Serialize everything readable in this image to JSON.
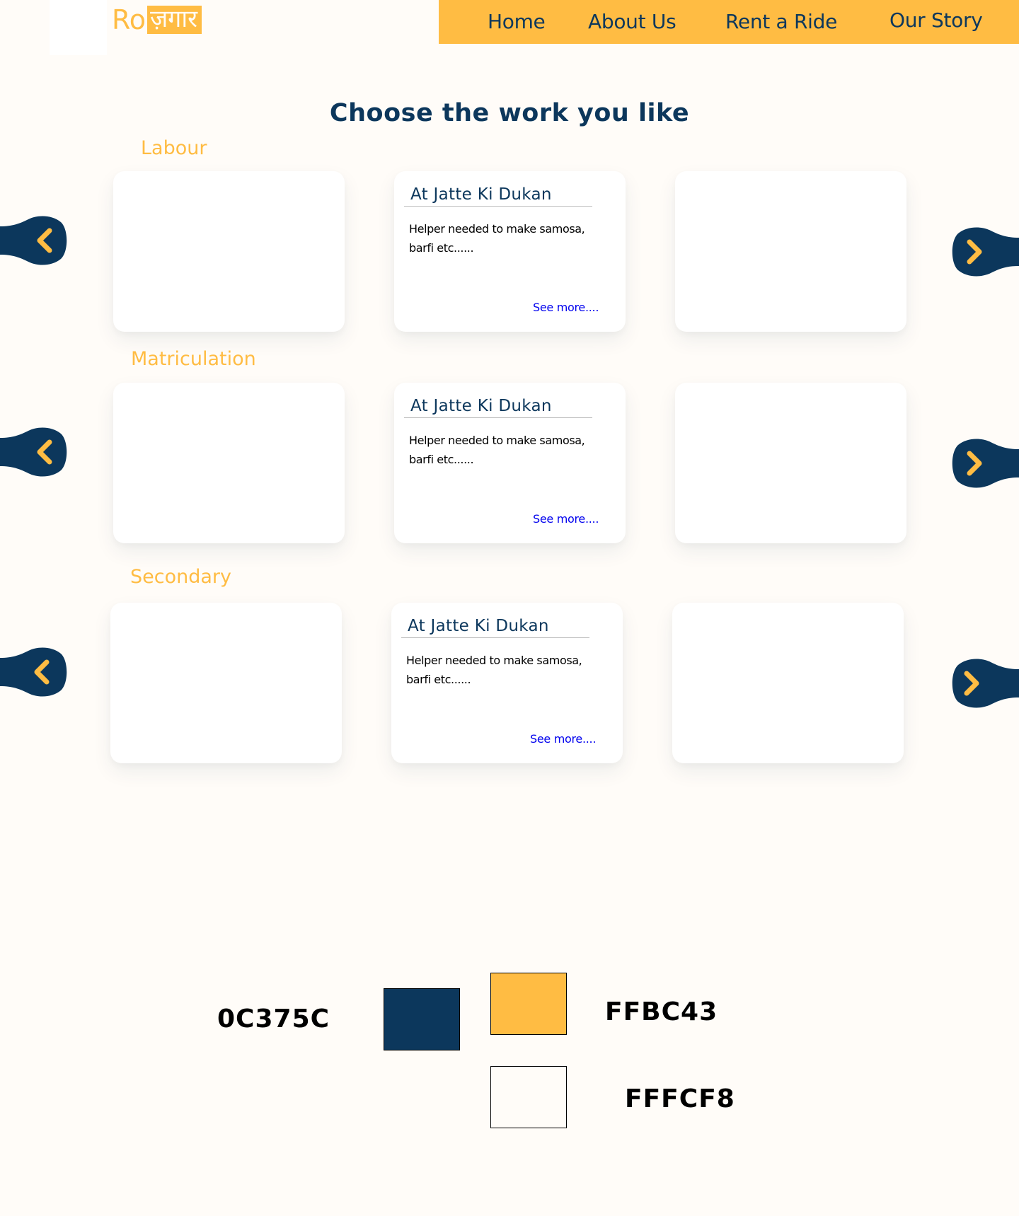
{
  "header": {
    "logo_latin": "Ro",
    "logo_devanagari": "ज़गार",
    "nav": [
      "Home",
      "About Us",
      "Rent a Ride",
      "Our Story"
    ]
  },
  "main": {
    "title": "Choose the work you like",
    "sections": [
      {
        "label": "Labour",
        "job": {
          "title": "At Jatte Ki Dukan",
          "description": "Helper needed to make samosa, barfi etc......",
          "link": "See more...."
        }
      },
      {
        "label": "Matriculation",
        "job": {
          "title": "At Jatte Ki Dukan",
          "description": "Helper needed to make samosa, barfi etc......",
          "link": "See more...."
        }
      },
      {
        "label": "Secondary",
        "job": {
          "title": "At Jatte Ki Dukan",
          "description": "Helper needed to make samosa, barfi etc......",
          "link": "See more...."
        }
      }
    ]
  },
  "palette": [
    {
      "hex": "0C375C",
      "color": "#0C375C"
    },
    {
      "hex": "FFBC43",
      "color": "#FFBC43"
    },
    {
      "hex": "FFFCF8",
      "color": "#FFFCF8"
    }
  ],
  "icons": {
    "prev": "chevron-left-icon",
    "next": "chevron-right-icon"
  },
  "colors": {
    "primary": "#0C375C",
    "accent": "#FFBC43",
    "background": "#FFFCF8",
    "card": "#FFFFFF",
    "link": "#0000EE"
  }
}
